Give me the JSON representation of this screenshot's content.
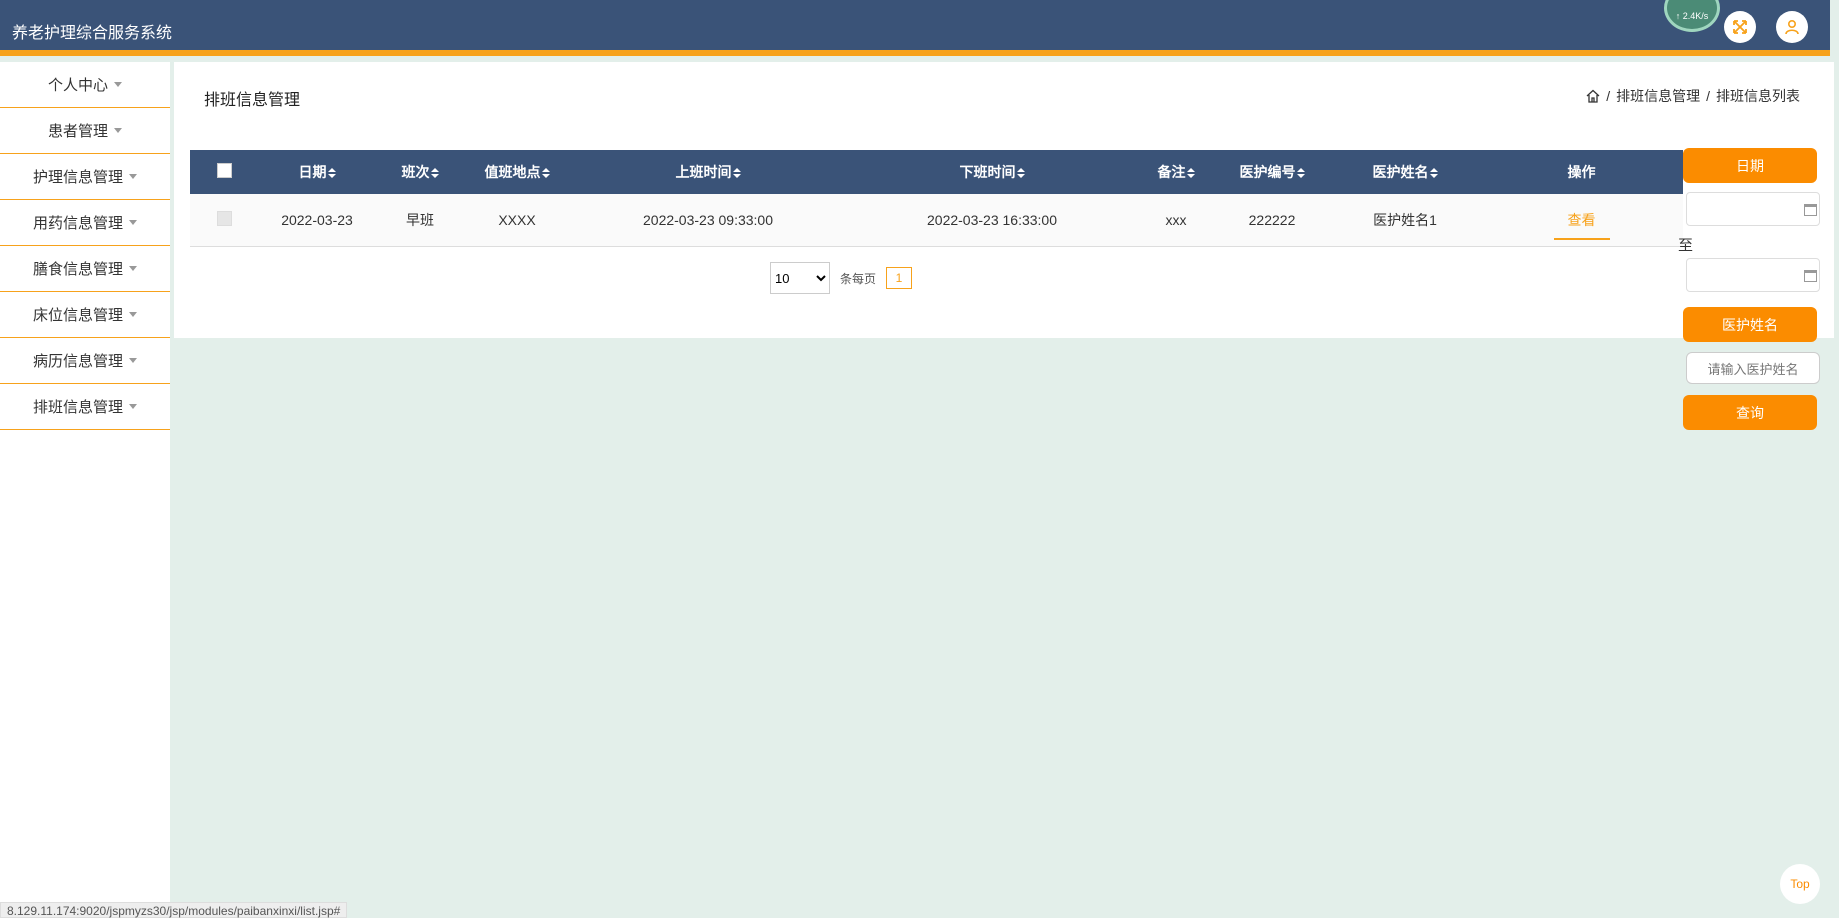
{
  "header": {
    "title": "养老护理综合服务系统",
    "network_speed": "↑ 2.4K/s"
  },
  "sidebar": {
    "items": [
      {
        "label": "个人中心"
      },
      {
        "label": "患者管理"
      },
      {
        "label": "护理信息管理"
      },
      {
        "label": "用药信息管理"
      },
      {
        "label": "膳食信息管理"
      },
      {
        "label": "床位信息管理"
      },
      {
        "label": "病历信息管理"
      },
      {
        "label": "排班信息管理"
      }
    ]
  },
  "main": {
    "page_title": "排班信息管理",
    "breadcrumb": {
      "section": "排班信息管理",
      "current": "排班信息列表",
      "separator": "/"
    },
    "table": {
      "headers": [
        "日期",
        "班次",
        "值班地点",
        "上班时间",
        "下班时间",
        "备注",
        "医护编号",
        "医护姓名",
        "操作"
      ],
      "rows": [
        [
          "2022-03-23",
          "早班",
          "XXXX",
          "2022-03-23 09:33:00",
          "2022-03-23 16:33:00",
          "xxx",
          "222222",
          "医护姓名1",
          "查看"
        ]
      ]
    },
    "pagination": {
      "page_size": "10",
      "per_page_label": "条每页",
      "current_page": "1"
    }
  },
  "search": {
    "date_button": "日期",
    "to_label": "至",
    "name_button": "医护姓名",
    "name_placeholder": "请输入医护姓名",
    "query_button": "查询"
  },
  "top_button": "Top",
  "statusbar_url": "8.129.11.174:9020/jspmyzs30/jsp/modules/paibanxinxi/list.jsp#",
  "colors": {
    "header_bg": "#3a5378",
    "accent": "#f7a21b",
    "button": "#fb8c00",
    "page_bg": "#e3efea"
  },
  "icons": [
    "fullscreen-icon",
    "user-icon",
    "home-icon",
    "calendar-icon",
    "caret-down-icon",
    "sort-icon"
  ]
}
